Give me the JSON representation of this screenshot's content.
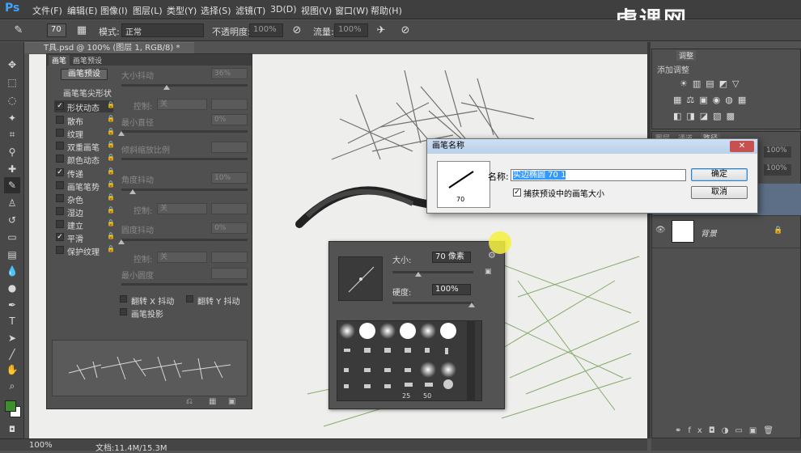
{
  "app": {
    "logo": "Ps"
  },
  "menu": [
    "文件(F)",
    "编辑(E)",
    "图像(I)",
    "图层(L)",
    "类型(Y)",
    "选择(S)",
    "滤镜(T)",
    "3D(D)",
    "视图(V)",
    "窗口(W)",
    "帮助(H)"
  ],
  "watermark": {
    "text": "虎课网",
    "sub": "HUKE88.COM"
  },
  "options": {
    "brush_size": "70",
    "mode_label": "模式:",
    "mode_value": "正常",
    "opacity_label": "不透明度:",
    "opacity_value": "100%",
    "flow_label": "流量:",
    "flow_value": "100%"
  },
  "doc_tab": "T具.psd @ 100% (图层 1, RGB/8) *",
  "brush_panel": {
    "tabs": [
      "画笔",
      "画笔预设"
    ],
    "preset_button": "画笔预设",
    "tip_shape_header": "画笔笔尖形状",
    "items": [
      {
        "label": "形状动态",
        "checked": true
      },
      {
        "label": "散布",
        "checked": false
      },
      {
        "label": "纹理",
        "checked": false
      },
      {
        "label": "双重画笔",
        "checked": false
      },
      {
        "label": "颜色动态",
        "checked": false
      },
      {
        "label": "传递",
        "checked": true
      },
      {
        "label": "画笔笔势",
        "checked": false
      },
      {
        "label": "杂色",
        "checked": false
      },
      {
        "label": "湿边",
        "checked": false
      },
      {
        "label": "建立",
        "checked": false
      },
      {
        "label": "平滑",
        "checked": true
      },
      {
        "label": "保护纹理",
        "checked": false
      }
    ],
    "size_jitter_label": "大小抖动",
    "size_jitter_value": "36%",
    "control_label": "控制:",
    "control_value": "关",
    "min_diameter_label": "最小直径",
    "min_diameter_value": "0%",
    "tilt_scale_label": "倾斜缩放比例",
    "angle_jitter_label": "角度抖动",
    "angle_jitter_value": "10%",
    "control2_value": "关",
    "roundness_jitter_label": "圆度抖动",
    "roundness_jitter_value": "0%",
    "control3_value": "关",
    "min_roundness_label": "最小圆度",
    "flip_x_label": "翻转 X 抖动",
    "flip_y_label": "翻转 Y 抖动",
    "projection_label": "画笔投影"
  },
  "dialog": {
    "title": "画笔名称",
    "close": "✕",
    "thumb_size": "70",
    "name_label": "名称:",
    "name_value": "实边椭圆 70 1",
    "capture_label": "捕获预设中的画笔大小",
    "ok": "确定",
    "cancel": "取消"
  },
  "brush_popup": {
    "size_label": "大小:",
    "size_value": "70 像素",
    "hardness_label": "硬度:",
    "hardness_value": "100%",
    "grid_numbers": [
      "25",
      "50"
    ]
  },
  "adjust_panel": {
    "tabs": [
      "调整"
    ],
    "title": "添加调整"
  },
  "layers_panel": {
    "tabs": [
      "图层",
      "通道",
      "路径"
    ],
    "opacity": "100%",
    "fill": "100%",
    "background_layer": "背景"
  },
  "status": {
    "zoom": "100%",
    "doc": "文档:11.4M/15.3M"
  },
  "colors": {
    "foreground": "#3c8f2a",
    "background": "#ffffff",
    "accent": "#3fa3ff"
  }
}
